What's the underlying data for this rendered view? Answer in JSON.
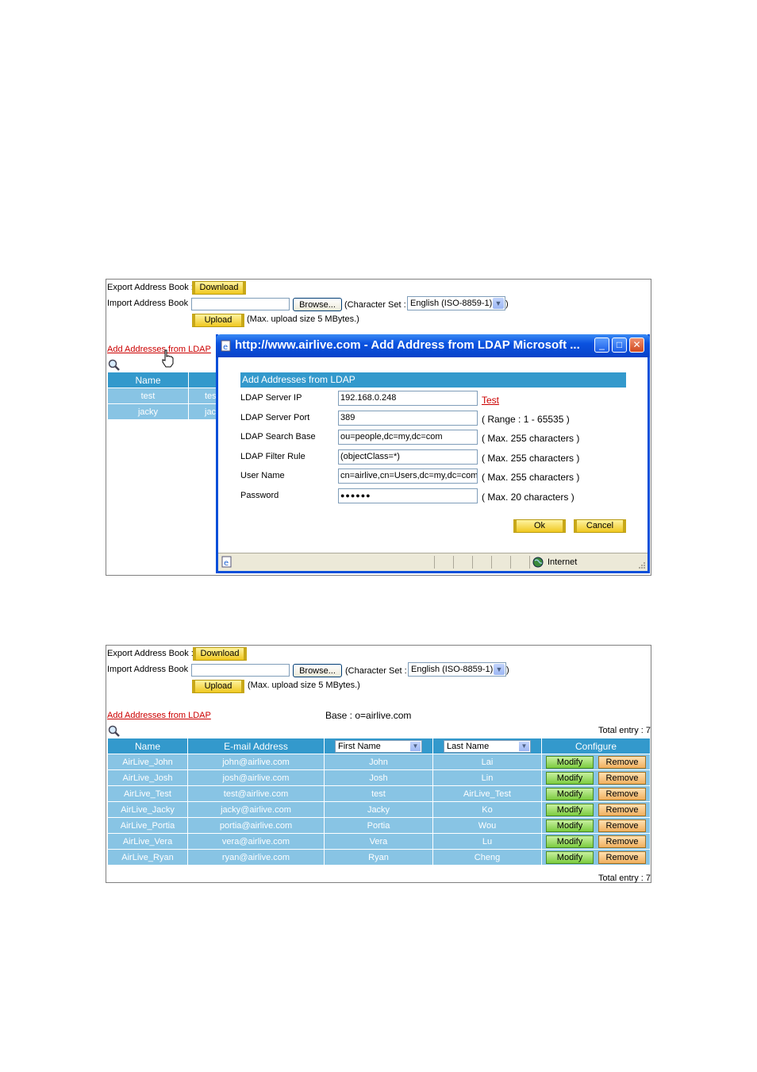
{
  "panel1": {
    "export_label": "Export Address Book :",
    "download_label": "Download",
    "import_label": "Import Address Book :",
    "browse_label": "Browse...",
    "charset_label": "(Character Set :",
    "charset_value": "English (ISO-8859-1)",
    "charset_close": ")",
    "upload_label": "Upload",
    "upload_note": "(Max. upload size 5 MBytes.)",
    "ldap_link": "Add Addresses from LDAP",
    "table": {
      "header_name": "Name",
      "rows": [
        {
          "name": "test",
          "partial": "tes"
        },
        {
          "name": "jacky",
          "partial": "jack"
        }
      ]
    }
  },
  "popup": {
    "title": "http://www.airlive.com - Add Address from LDAP Microsoft ...",
    "header": "Add Addresses from LDAP",
    "fields": [
      {
        "label": "LDAP Server IP",
        "value": "192.168.0.248",
        "hint": "Test"
      },
      {
        "label": "LDAP Server Port",
        "value": "389",
        "hint": "( Range : 1 - 65535 )"
      },
      {
        "label": "LDAP Search Base",
        "value": "ou=people,dc=my,dc=com",
        "hint": "( Max. 255 characters )"
      },
      {
        "label": "LDAP Filter Rule",
        "value": "(objectClass=*)",
        "hint": "( Max. 255 characters )"
      },
      {
        "label": "User Name",
        "value": "cn=airlive,cn=Users,dc=my,dc=com",
        "hint": "( Max. 255 characters )"
      },
      {
        "label": "Password",
        "value": "●●●●●●",
        "hint": "( Max. 20 characters )"
      }
    ],
    "ok_label": "Ok",
    "cancel_label": "Cancel",
    "status_zone": "Internet"
  },
  "panel2": {
    "export_label": "Export Address Book :",
    "download_label": "Download",
    "import_label": "Import Address Book :",
    "browse_label": "Browse...",
    "charset_label": "(Character Set :",
    "charset_value": "English (ISO-8859-1)",
    "charset_close": ")",
    "upload_label": "Upload",
    "upload_note": "(Max. upload size 5 MBytes.)",
    "ldap_link": "Add Addresses from LDAP",
    "base_text": "Base : o=airlive.com",
    "total_entry": "Total entry : 7",
    "columns": {
      "name": "Name",
      "email": "E-mail Address",
      "first_name": "First Name",
      "last_name": "Last Name",
      "configure": "Configure"
    },
    "modify_label": "Modify",
    "remove_label": "Remove",
    "rows": [
      {
        "name": "AirLive_John",
        "email": "john@airlive.com",
        "first": "John",
        "last": "Lai"
      },
      {
        "name": "AirLive_Josh",
        "email": "josh@airlive.com",
        "first": "Josh",
        "last": "Lin"
      },
      {
        "name": "AirLive_Test",
        "email": "test@airlive.com",
        "first": "test",
        "last": "AirLive_Test"
      },
      {
        "name": "AirLive_Jacky",
        "email": "jacky@airlive.com",
        "first": "Jacky",
        "last": "Ko"
      },
      {
        "name": "AirLive_Portia",
        "email": "portia@airlive.com",
        "first": "Portia",
        "last": "Wou"
      },
      {
        "name": "AirLive_Vera",
        "email": "vera@airlive.com",
        "first": "Vera",
        "last": "Lu"
      },
      {
        "name": "AirLive_Ryan",
        "email": "ryan@airlive.com",
        "first": "Ryan",
        "last": "Cheng"
      }
    ]
  }
}
